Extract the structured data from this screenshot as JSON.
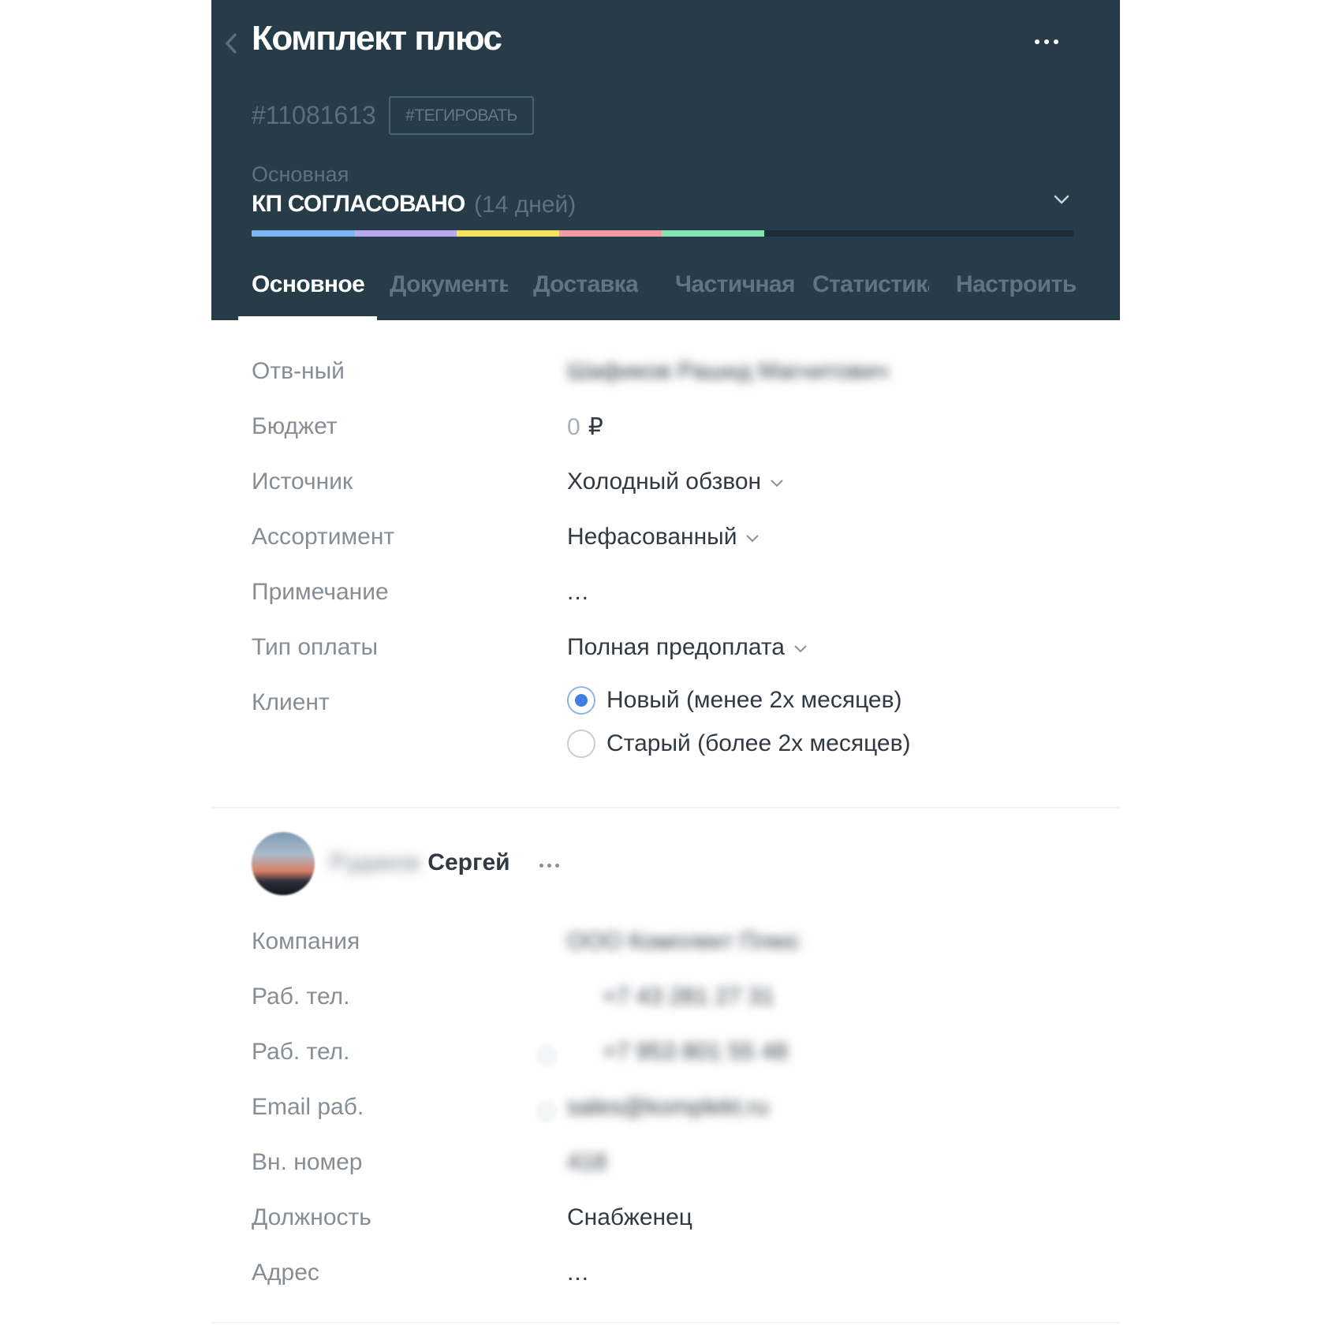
{
  "header": {
    "title": "Комплект плюс",
    "lead_id": "#11081613",
    "tag_button": "#ТЕГИРОВАТЬ",
    "pipeline": "Основная",
    "status": "КП СОГЛАСОВАНО",
    "status_duration": "(14 дней)",
    "progress_colors": [
      "#79b6f0",
      "#b8a9ec",
      "#f2e35e",
      "#f29aa3",
      "#84e3b3"
    ],
    "progress_filled_stages": 5,
    "progress_total_stages": 8
  },
  "tabs": [
    {
      "label": "Основное",
      "active": true
    },
    {
      "label": "Документы",
      "active": false
    },
    {
      "label": "Доставка",
      "active": false
    },
    {
      "label": "Частичная",
      "active": false
    },
    {
      "label": "Статистика",
      "active": false
    },
    {
      "label": "Настроить",
      "active": false
    }
  ],
  "fields": {
    "responsible": {
      "label": "Отв-ный",
      "value": "Шафиков Рашид Магнитович"
    },
    "budget": {
      "label": "Бюджет",
      "amount": "0",
      "currency": "₽"
    },
    "source": {
      "label": "Источник",
      "value": "Холодный обзвон"
    },
    "assortment": {
      "label": "Ассортимент",
      "value": "Нефасованный"
    },
    "note": {
      "label": "Примечание",
      "value": "..."
    },
    "payment_type": {
      "label": "Тип оплаты",
      "value": "Полная предоплата"
    },
    "client": {
      "label": "Клиент",
      "options": [
        {
          "label": "Новый (менее 2х месяцев)",
          "selected": true
        },
        {
          "label": "Старый (более 2х месяцев)",
          "selected": false
        }
      ]
    }
  },
  "contact": {
    "surname": "Рудаков",
    "first_name": "Сергей",
    "fields": {
      "company": {
        "label": "Компания",
        "value": "ООО Комплект Плюс"
      },
      "work_phone_1": {
        "label": "Раб. тел.",
        "value": "+7 43 281 27 31"
      },
      "work_phone_2": {
        "label": "Раб. тел.",
        "value": "+7 953 801 55 48"
      },
      "email": {
        "label": "Email раб.",
        "value": "sales@komplekt.ru"
      },
      "ext": {
        "label": "Вн. номер",
        "value": "418"
      },
      "position": {
        "label": "Должность",
        "value": "Снабженец"
      },
      "address": {
        "label": "Адрес",
        "value": "..."
      }
    }
  }
}
